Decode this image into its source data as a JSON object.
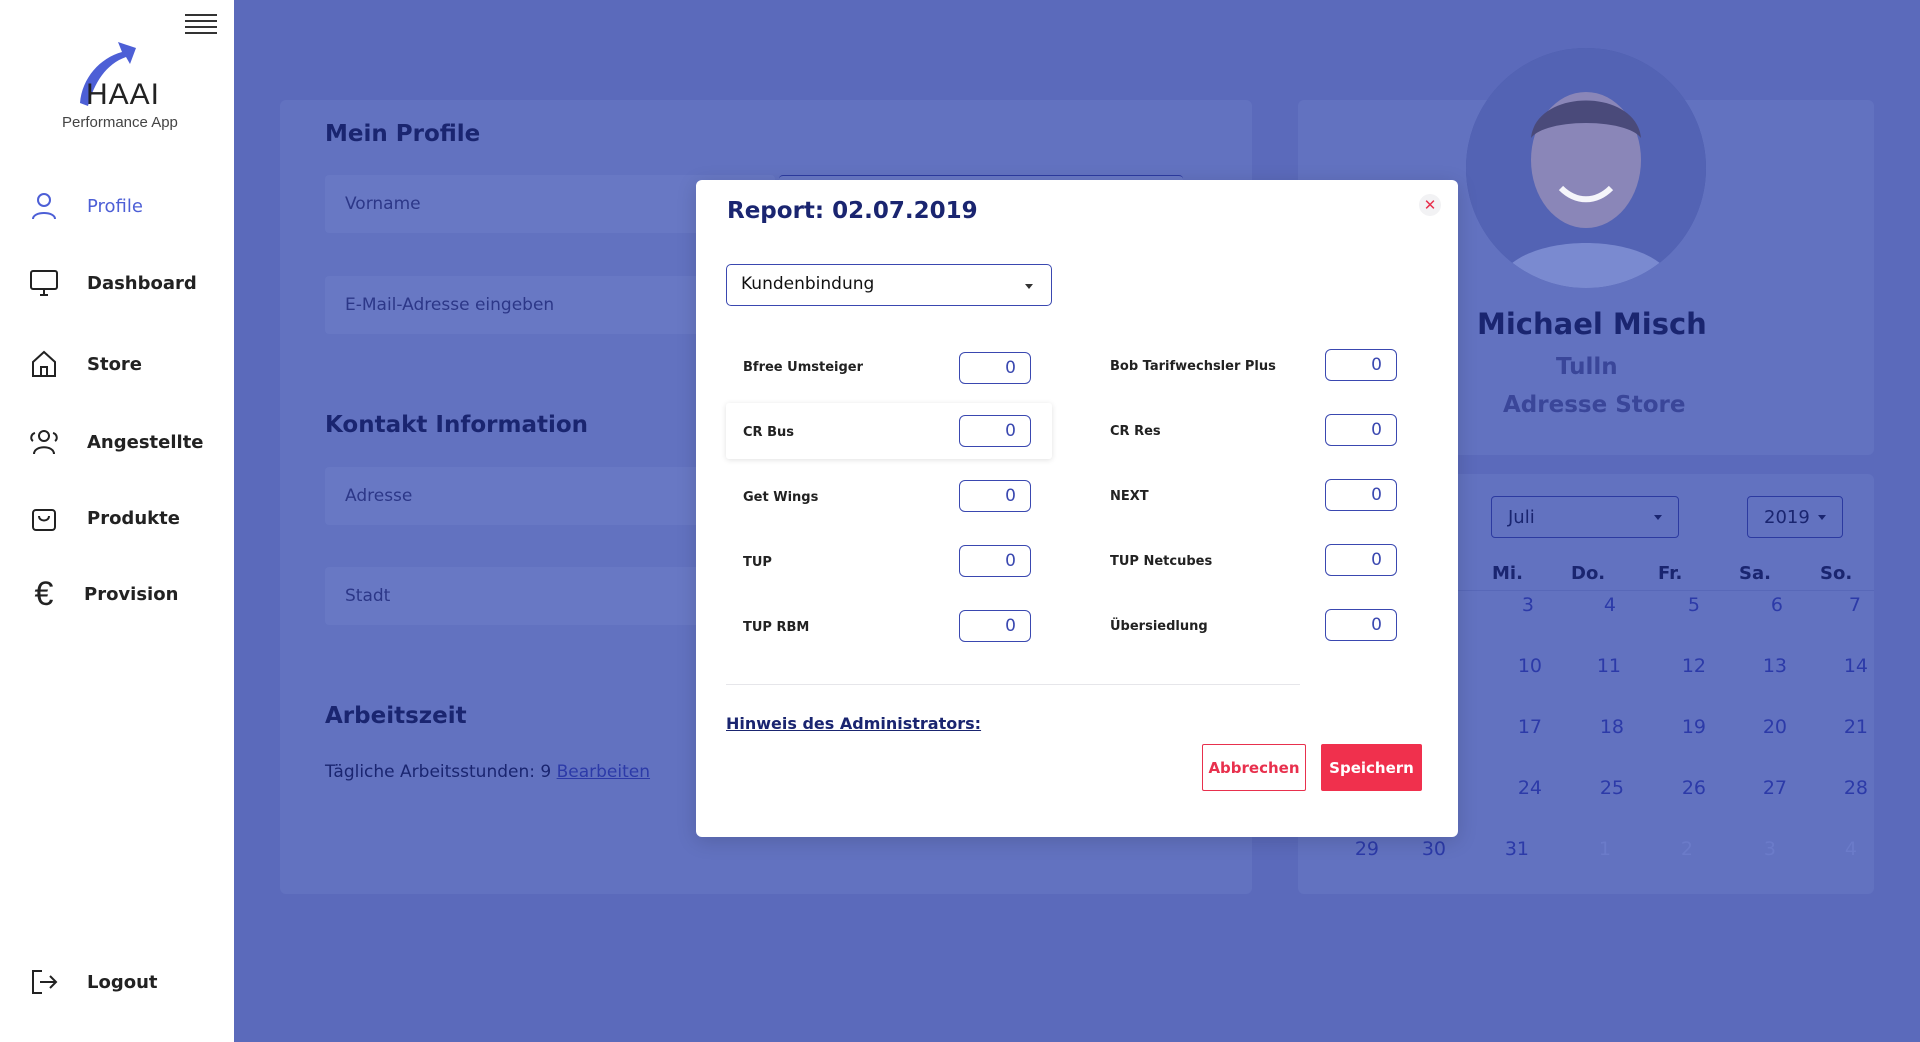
{
  "app": {
    "logo_text": "HAAI",
    "logo_subtitle": "Performance App"
  },
  "sidebar": {
    "items": [
      {
        "label": "Profile",
        "icon": "user-icon",
        "active": true
      },
      {
        "label": "Dashboard",
        "icon": "monitor-icon"
      },
      {
        "label": "Store",
        "icon": "home-icon"
      },
      {
        "label": "Angestellte",
        "icon": "users-icon"
      },
      {
        "label": "Produkte",
        "icon": "shopping-bag-icon"
      },
      {
        "label": "Provision",
        "icon": "euro-icon"
      }
    ],
    "logout": "Logout",
    "accent": "#4d5fd6"
  },
  "profile_form": {
    "title": "Mein Profile",
    "vorname_placeholder": "Vorname",
    "email_placeholder": "E-Mail-Adresse eingeben",
    "kontakt_title": "Kontakt Information",
    "adresse_placeholder": "Adresse",
    "stadt_placeholder": "Stadt",
    "arbeitszeit_title": "Arbeitszeit",
    "arbeitsstunden_text": "Tägliche Arbeitsstunden: 9",
    "edit_link": "Bearbeiten"
  },
  "profile_card": {
    "name": "Michael Misch",
    "city": "Tulln",
    "store": "Adresse Store"
  },
  "calendar": {
    "month": "Juli",
    "year": "2019",
    "weekdays": [
      "Mi.",
      "Do.",
      "Fr.",
      "Sa.",
      "So."
    ],
    "rows": [
      [
        "3",
        "4",
        "5",
        "6",
        "7"
      ],
      [
        "10",
        "11",
        "12",
        "13",
        "14"
      ],
      [
        "17",
        "18",
        "19",
        "20",
        "21"
      ],
      [
        "24",
        "25",
        "26",
        "27",
        "28"
      ]
    ],
    "last_row": [
      "29",
      "30",
      "31",
      "1",
      "2",
      "3",
      "4"
    ]
  },
  "modal": {
    "title": "Report: 02.07.2019",
    "category": "Kundenbindung",
    "fields_left": [
      {
        "label": "Bfree Umsteiger",
        "value": "0"
      },
      {
        "label": "CR Bus",
        "value": "0"
      },
      {
        "label": "Get Wings",
        "value": "0"
      },
      {
        "label": "TUP",
        "value": "0"
      },
      {
        "label": "TUP RBM",
        "value": "0"
      }
    ],
    "fields_right": [
      {
        "label": "Bob Tarifwechsler Plus",
        "value": "0"
      },
      {
        "label": "CR Res",
        "value": "0"
      },
      {
        "label": "NEXT",
        "value": "0"
      },
      {
        "label": "TUP Netcubes",
        "value": "0"
      },
      {
        "label": "Übersiedlung",
        "value": "0"
      }
    ],
    "admin_note": "Hinweis des Administrators:",
    "cancel": "Abbrechen",
    "save": "Speichern",
    "danger_color": "#f0304d"
  }
}
